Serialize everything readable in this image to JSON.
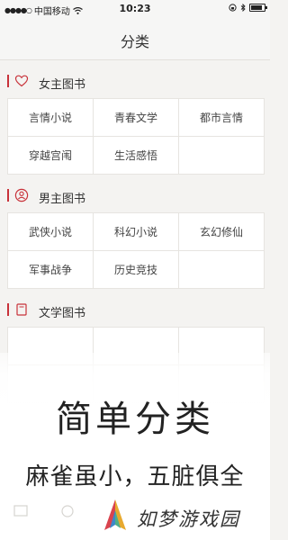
{
  "status_bar": {
    "carrier": "中国移动",
    "time": "10:23",
    "battery_level": 0.85
  },
  "nav": {
    "title": "分类"
  },
  "sections": [
    {
      "title": "女主图书",
      "icon": "heart-icon",
      "items": [
        "言情小说",
        "青春文学",
        "都市言情",
        "穿越宫闱",
        "生活感悟"
      ]
    },
    {
      "title": "男主图书",
      "icon": "person-icon",
      "items": [
        "武侠小说",
        "科幻小说",
        "玄幻修仙",
        "军事战争",
        "历史竞技"
      ]
    },
    {
      "title": "文学图书",
      "icon": "book-icon"
    }
  ],
  "promo": {
    "title": "简单分类",
    "subtitle": "麻雀虽小，五脏俱全"
  },
  "watermark": {
    "site_name": "如梦游戏园"
  },
  "colors": {
    "accent": "#c8323a",
    "background": "#f4f3f1"
  }
}
